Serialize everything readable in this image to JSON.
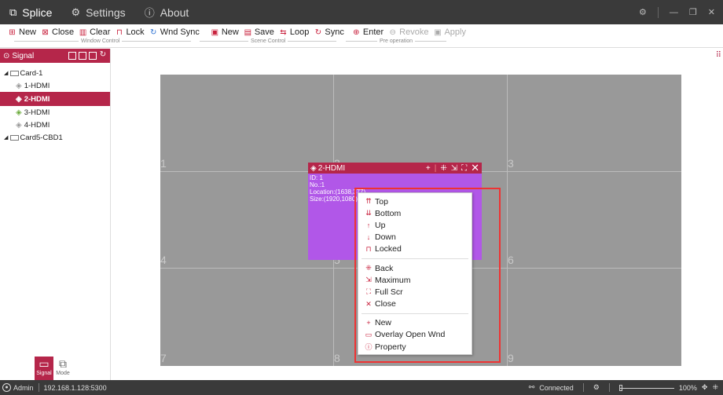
{
  "titlebar": {
    "tabs": [
      {
        "icon": "window-icon",
        "label": "Splice"
      },
      {
        "icon": "gear-icon",
        "label": "Settings"
      },
      {
        "icon": "info-icon",
        "label": "About"
      }
    ]
  },
  "toolbar": {
    "window_control": {
      "label": "Window Control",
      "items": [
        {
          "icon": "new-window-icon",
          "label": "New"
        },
        {
          "icon": "close-window-icon",
          "label": "Close"
        },
        {
          "icon": "trash-icon",
          "label": "Clear"
        },
        {
          "icon": "lock-icon",
          "label": "Lock"
        },
        {
          "icon": "sync-icon",
          "label": "Wnd Sync"
        }
      ]
    },
    "scene_control": {
      "label": "Scene Control",
      "items": [
        {
          "icon": "new-scene-icon",
          "label": "New"
        },
        {
          "icon": "save-icon",
          "label": "Save"
        },
        {
          "icon": "loop-icon",
          "label": "Loop"
        },
        {
          "icon": "sync-icon",
          "label": "Sync"
        }
      ]
    },
    "pre_operation": {
      "label": "Pre operation",
      "items": [
        {
          "icon": "enter-icon",
          "label": "Enter",
          "enabled": true
        },
        {
          "icon": "revoke-icon",
          "label": "Revoke",
          "enabled": false
        },
        {
          "icon": "apply-icon",
          "label": "Apply",
          "enabled": false
        }
      ]
    }
  },
  "signal_panel": {
    "title": "Signal",
    "tree": [
      {
        "label": "Card-1",
        "children": [
          "1-HDMI",
          "2-HDMI",
          "3-HDMI",
          "4-HDMI"
        ],
        "selected": "2-HDMI"
      },
      {
        "label": "Card5-CBD1",
        "children": []
      }
    ]
  },
  "mode_tabs": [
    {
      "label": "Signal",
      "active": true
    },
    {
      "label": "Mode",
      "active": false
    }
  ],
  "screen_grid": {
    "cells": [
      "1",
      "2",
      "3",
      "4",
      "5",
      "6",
      "7",
      "8",
      "9"
    ]
  },
  "window": {
    "title": "2-HDMI",
    "id_line": "ID: 1",
    "no_line": "No.:1",
    "location_line": "Location:(1638,377)",
    "size_line": "Size:(1920,1080)"
  },
  "context_menu": {
    "group1": [
      "Top",
      "Bottom",
      "Up",
      "Down",
      "Locked"
    ],
    "group2": [
      "Back",
      "Maximum",
      "Full Scr",
      "Close"
    ],
    "group3": [
      "New",
      "Overlay Open Wnd",
      "Property"
    ]
  },
  "statusbar": {
    "user": "Admin",
    "ip": "192.168.1.128:5300",
    "connection": "Connected",
    "zoom": "100%"
  },
  "colors": {
    "accent": "#b5264a",
    "window_fill": "#b157e8",
    "grid_bg": "#999999",
    "highlight_box": "#ee3333"
  }
}
